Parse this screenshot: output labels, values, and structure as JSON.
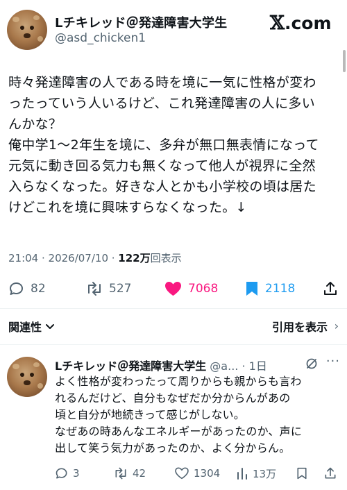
{
  "post": {
    "author_name": "Lチキレッド＠発達障害大学生",
    "author_handle": "@asd_chicken1",
    "site_label": "com",
    "site_mark": "𝕏",
    "avatar_icon": "fried-chicken-avatar-icon",
    "text_lines": [
      "時々発達障害の人である時を境に一気に性格が変わ",
      "ったっていう人いるけど、これ発達障害の人に多い",
      "んかな？",
      "俺中学1〜2年生を境に、多弁が無口無表情になって",
      "元気に動き回る気力も無くなって他人が視界に全然",
      "入らなくなった。好きな人とかも小学校の頃は居た",
      "けどこれを境に興味すらなくなった。↓"
    ],
    "timestamp": "21:04 · 2026/07/10 · ",
    "views_count": "122万",
    "views_label": "回表示",
    "stats": {
      "replies": "82",
      "reposts": "527",
      "likes": "7068",
      "bookmarks": "2118"
    },
    "colors": {
      "like": "#f91880",
      "bookmark": "#1d9bf0",
      "muted": "#536471"
    }
  },
  "links": {
    "related": "関連性",
    "quotes": "引用を表示",
    "chevron": "›"
  },
  "reply": {
    "author_name": "Lチキレッド＠発達障害大学生",
    "handle_trunc": "@a...",
    "separator": "·",
    "time_ago": "1日",
    "more": "···",
    "text_lines": [
      "よく性格が変わったって周りからも親からも言わ",
      "れるんだけど、自分もなぜだか分からんがあの",
      "頃と自分が地続きって感じがしない。",
      "なぜあの時あんなエネルギーがあったのか、声に",
      "出して笑う気力があったのか、よく分からん。"
    ],
    "stats": {
      "replies": "3",
      "reposts": "42",
      "likes": "1304",
      "views": "13万"
    }
  }
}
